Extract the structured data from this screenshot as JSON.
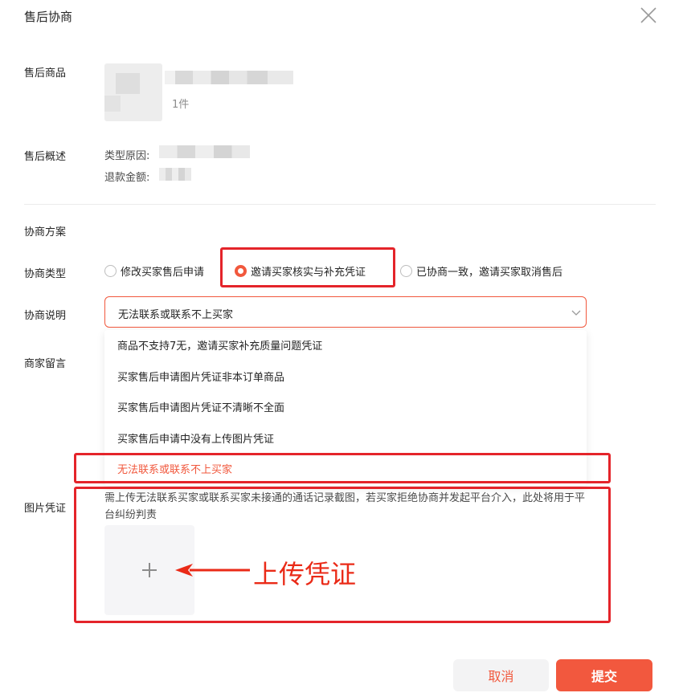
{
  "dialog": {
    "title": "售后协商"
  },
  "product": {
    "label": "售后商品",
    "quantity": "1件"
  },
  "summary": {
    "label": "售后概述",
    "reason_label": "类型原因:",
    "refund_label": "退款金额:"
  },
  "plan": {
    "section_label": "协商方案",
    "type_label": "协商类型",
    "desc_label": "协商说明",
    "note_label": "商家留言",
    "proof_label": "图片凭证"
  },
  "radio_options": [
    {
      "label": "修改买家售后申请",
      "checked": false
    },
    {
      "label": "邀请买家核实与补充凭证",
      "checked": true
    },
    {
      "label": "已协商一致，邀请买家取消售后",
      "checked": false
    }
  ],
  "select": {
    "value": "无法联系或联系不上买家"
  },
  "dropdown_options": [
    {
      "label": "商品不支持7无，邀请买家补充质量问题凭证",
      "selected": false
    },
    {
      "label": "买家售后申请图片凭证非本订单商品",
      "selected": false
    },
    {
      "label": "买家售后申请图片凭证不清晰不全面",
      "selected": false
    },
    {
      "label": "买家售后申请中没有上传图片凭证",
      "selected": false
    },
    {
      "label": "无法联系或联系不上买家",
      "selected": true
    }
  ],
  "hint": "需上传无法联系买家或联系买家未接通的通话记录截图，若买家拒绝协商并发起平台介入，此处将用于平台纠纷判责",
  "annotation": {
    "upload_callout": "上传凭证"
  },
  "buttons": {
    "cancel": "取消",
    "submit": "提交"
  },
  "colors": {
    "accent": "#f1583d",
    "annotation_red": "#e4242a",
    "text": "#252525",
    "muted": "#8c8c8c"
  }
}
